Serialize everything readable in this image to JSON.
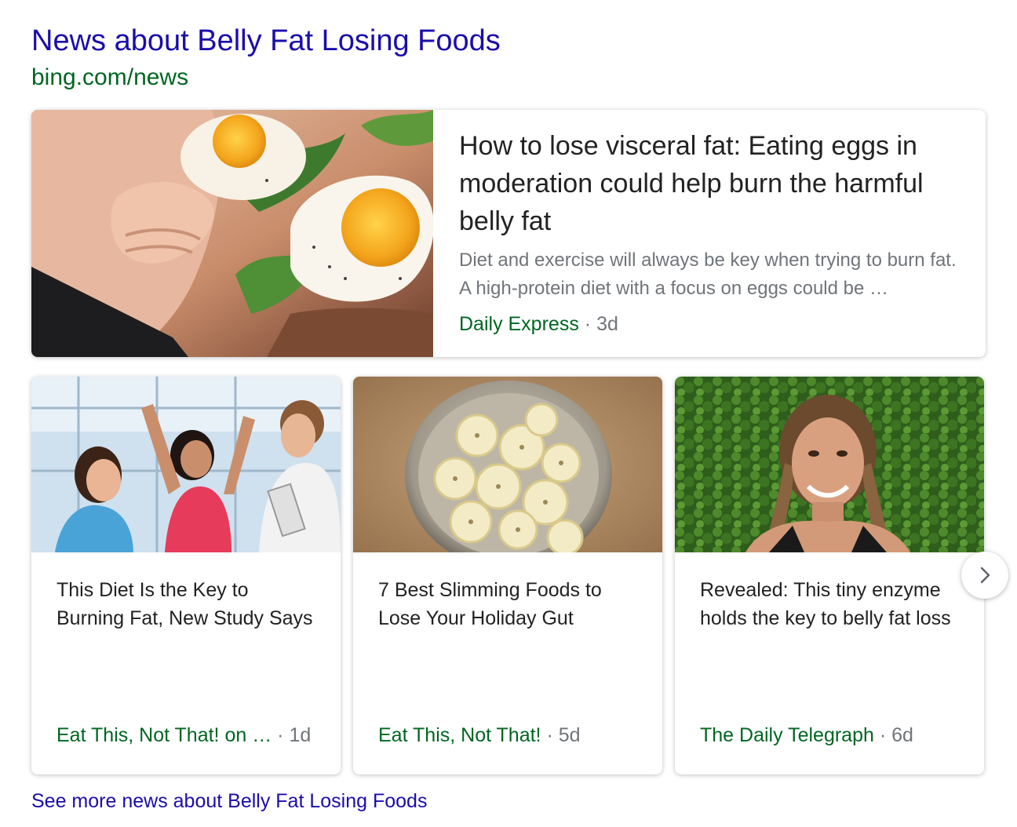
{
  "header": {
    "title": "News about Belly Fat Losing Foods",
    "source": "bing.com/news"
  },
  "top_story": {
    "image_icon": "eggs-belly-photo",
    "headline": "How to lose visceral fat: Eating eggs in moderation could help burn the harmful belly fat",
    "snippet": "Diet and exercise will always be key when trying to burn fat. A high-protein diet with a focus on eggs could be …",
    "source": "Daily Express",
    "separator": "·",
    "age": "3d"
  },
  "stories": [
    {
      "image_icon": "fitness-group-photo",
      "headline": "This Diet Is the Key to Burning Fat, New Study Says",
      "source": "Eat This, Not That! on …",
      "separator": "·",
      "age": "1d"
    },
    {
      "image_icon": "banana-bowl-photo",
      "headline": "7 Best Slimming Foods to Lose Your Holiday Gut",
      "source": "Eat This, Not That!",
      "separator": "·",
      "age": "5d"
    },
    {
      "image_icon": "woman-portrait-photo",
      "headline": "Revealed: This tiny enzyme holds the key to belly fat loss",
      "source": "The Daily Telegraph",
      "separator": "·",
      "age": "6d"
    }
  ],
  "carousel": {
    "next_icon": "chevron-right-icon"
  },
  "footer": {
    "more_link": "See more news about Belly Fat Losing Foods"
  },
  "colors": {
    "title_link": "#1a0dab",
    "source_green": "#006621",
    "meta_gray": "#70757a",
    "headline": "#222222"
  }
}
